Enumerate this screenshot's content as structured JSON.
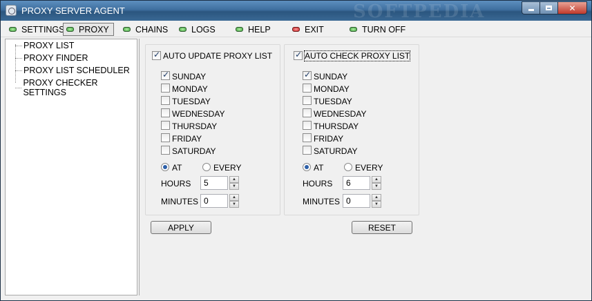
{
  "window": {
    "title": "PROXY SERVER AGENT",
    "watermark": "SOFTPEDIA"
  },
  "colors": {
    "led_green": "#3aa13a",
    "led_red": "#d02020",
    "title_bar": "#3f6f9f"
  },
  "menu": [
    {
      "label": "SETTINGS",
      "led": "green"
    },
    {
      "label": "PROXY",
      "led": "green",
      "active": true
    },
    {
      "label": "CHAINS",
      "led": "green"
    },
    {
      "label": "LOGS",
      "led": "green"
    },
    {
      "label": "HELP",
      "led": "green"
    },
    {
      "label": "EXIT",
      "led": "red"
    },
    {
      "label": "TURN OFF",
      "led": "green"
    }
  ],
  "tree": [
    "PROXY LIST",
    "PROXY FINDER",
    "PROXY LIST SCHEDULER",
    "PROXY CHECKER SETTINGS"
  ],
  "panel_update": {
    "title": "AUTO UPDATE PROXY LIST",
    "title_checked": true,
    "days": [
      {
        "label": "SUNDAY",
        "checked": true
      },
      {
        "label": "MONDAY",
        "checked": false
      },
      {
        "label": "TUESDAY",
        "checked": false
      },
      {
        "label": "WEDNESDAY",
        "checked": false
      },
      {
        "label": "THURSDAY",
        "checked": false
      },
      {
        "label": "FRIDAY",
        "checked": false
      },
      {
        "label": "SATURDAY",
        "checked": false
      }
    ],
    "radio_at": "AT",
    "radio_every": "EVERY",
    "selected": "at",
    "hours_label": "HOURS",
    "hours_value": "5",
    "minutes_label": "MINUTES",
    "minutes_value": "0"
  },
  "panel_check": {
    "title": "AUTO CHECK PROXY LIST",
    "title_checked": true,
    "days": [
      {
        "label": "SUNDAY",
        "checked": true
      },
      {
        "label": "MONDAY",
        "checked": false
      },
      {
        "label": "TUESDAY",
        "checked": false
      },
      {
        "label": "WEDNESDAY",
        "checked": false
      },
      {
        "label": "THURSDAY",
        "checked": false
      },
      {
        "label": "FRIDAY",
        "checked": false
      },
      {
        "label": "SATURDAY",
        "checked": false
      }
    ],
    "radio_at": "AT",
    "radio_every": "EVERY",
    "selected": "at",
    "hours_label": "HOURS",
    "hours_value": "6",
    "minutes_label": "MINUTES",
    "minutes_value": "0"
  },
  "buttons": {
    "apply": "APPLY",
    "reset": "RESET"
  }
}
